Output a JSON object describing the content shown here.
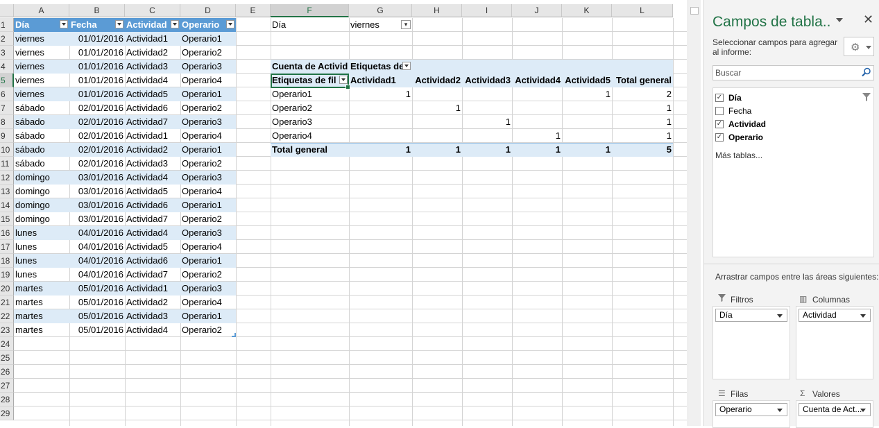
{
  "columns": [
    "A",
    "B",
    "C",
    "D",
    "E",
    "F",
    "G",
    "H",
    "I",
    "J",
    "K",
    "L"
  ],
  "rows": [
    "1",
    "2",
    "3",
    "4",
    "5",
    "6",
    "7",
    "8",
    "9",
    "10",
    "11",
    "12",
    "13",
    "14",
    "15",
    "16",
    "17",
    "18",
    "19",
    "20",
    "21",
    "22",
    "23",
    "24",
    "25",
    "26",
    "27",
    "28",
    "29"
  ],
  "table": {
    "headers": [
      "Día",
      "Fecha",
      "Actividad",
      "Operario"
    ],
    "rows": [
      [
        "viernes",
        "01/01/2016",
        "Actividad1",
        "Operario1"
      ],
      [
        "viernes",
        "01/01/2016",
        "Actividad2",
        "Operario2"
      ],
      [
        "viernes",
        "01/01/2016",
        "Actividad3",
        "Operario3"
      ],
      [
        "viernes",
        "01/01/2016",
        "Actividad4",
        "Operario4"
      ],
      [
        "viernes",
        "01/01/2016",
        "Actividad5",
        "Operario1"
      ],
      [
        "sábado",
        "02/01/2016",
        "Actividad6",
        "Operario2"
      ],
      [
        "sábado",
        "02/01/2016",
        "Actividad7",
        "Operario3"
      ],
      [
        "sábado",
        "02/01/2016",
        "Actividad1",
        "Operario4"
      ],
      [
        "sábado",
        "02/01/2016",
        "Actividad2",
        "Operario1"
      ],
      [
        "sábado",
        "02/01/2016",
        "Actividad3",
        "Operario2"
      ],
      [
        "domingo",
        "03/01/2016",
        "Actividad4",
        "Operario3"
      ],
      [
        "domingo",
        "03/01/2016",
        "Actividad5",
        "Operario4"
      ],
      [
        "domingo",
        "03/01/2016",
        "Actividad6",
        "Operario1"
      ],
      [
        "domingo",
        "03/01/2016",
        "Actividad7",
        "Operario2"
      ],
      [
        "lunes",
        "04/01/2016",
        "Actividad4",
        "Operario3"
      ],
      [
        "lunes",
        "04/01/2016",
        "Actividad5",
        "Operario4"
      ],
      [
        "lunes",
        "04/01/2016",
        "Actividad6",
        "Operario1"
      ],
      [
        "lunes",
        "04/01/2016",
        "Actividad7",
        "Operario2"
      ],
      [
        "martes",
        "05/01/2016",
        "Actividad1",
        "Operario3"
      ],
      [
        "martes",
        "05/01/2016",
        "Actividad2",
        "Operario4"
      ],
      [
        "martes",
        "05/01/2016",
        "Actividad3",
        "Operario1"
      ],
      [
        "martes",
        "05/01/2016",
        "Actividad4",
        "Operario2"
      ]
    ]
  },
  "pivot": {
    "filter_label": "Día",
    "filter_value": "viernes",
    "values_caption": "Cuenta de Activid",
    "col_labels_caption": "Etiquetas de",
    "row_labels_caption": "Etiquetas de fil",
    "col_headers": [
      "Actividad1",
      "Actividad2",
      "Actividad3",
      "Actividad4",
      "Actividad5",
      "Total general"
    ],
    "rows": [
      {
        "label": "Operario1",
        "cells": [
          "1",
          "",
          "",
          "",
          "1",
          "2"
        ]
      },
      {
        "label": "Operario2",
        "cells": [
          "",
          "1",
          "",
          "",
          "",
          "1"
        ]
      },
      {
        "label": "Operario3",
        "cells": [
          "",
          "",
          "1",
          "",
          "",
          "1"
        ]
      },
      {
        "label": "Operario4",
        "cells": [
          "",
          "",
          "",
          "1",
          "",
          "1"
        ]
      }
    ],
    "total": {
      "label": "Total general",
      "cells": [
        "1",
        "1",
        "1",
        "1",
        "1",
        "5"
      ]
    }
  },
  "panel": {
    "title": "Campos de tabla..",
    "subtitle": "Seleccionar campos para agregar al informe:",
    "search_placeholder": "Buscar",
    "fields": [
      {
        "name": "Día",
        "checked": true
      },
      {
        "name": "Fecha",
        "checked": false
      },
      {
        "name": "Actividad",
        "checked": true
      },
      {
        "name": "Operario",
        "checked": true
      }
    ],
    "more_tables": "Más tablas...",
    "drag_text": "Arrastrar campos entre las áreas siguientes:",
    "areas": {
      "filters": {
        "label": "Filtros",
        "item": "Día"
      },
      "columns": {
        "label": "Columnas",
        "item": "Actividad"
      },
      "rows": {
        "label": "Filas",
        "item": "Operario"
      },
      "values": {
        "label": "Valores",
        "item": "Cuenta de Act..."
      }
    }
  },
  "colors": {
    "accent": "#217346",
    "table_header": "#5b9bd5",
    "band": "#ddebf7"
  }
}
